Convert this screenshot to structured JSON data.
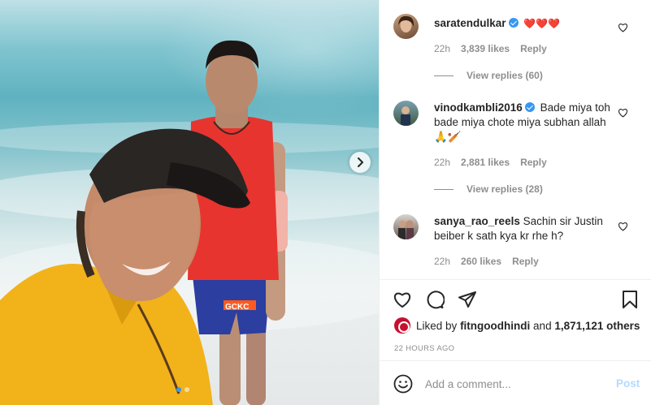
{
  "post_photo": {
    "cap_text": "GCKC"
  },
  "carousel": {
    "next_icon": "chevron-right-icon",
    "slide_count": 2,
    "active_index": 0
  },
  "comments": [
    {
      "username": "saratendulkar",
      "verified": true,
      "text": "❤️❤️❤️",
      "time": "22h",
      "likes": "3,839 likes",
      "reply_label": "Reply",
      "view_replies": "View replies (60)"
    },
    {
      "username": "vinodkambli2016",
      "verified": true,
      "text": "Bade miya toh bade miya chote miya subhan allah🙏🏏",
      "time": "22h",
      "likes": "2,881 likes",
      "reply_label": "Reply",
      "view_replies": "View replies (28)"
    },
    {
      "username": "sanya_rao_reels",
      "verified": false,
      "text": "Sachin sir Justin beiber k sath kya kr rhe h?",
      "time": "22h",
      "likes": "260 likes",
      "reply_label": "Reply"
    }
  ],
  "actions": {
    "like_icon": "heart-outline-icon",
    "comment_icon": "comment-bubble-icon",
    "share_icon": "paper-plane-icon",
    "save_icon": "bookmark-icon"
  },
  "likes_summary": {
    "prefix": "Liked by",
    "user": "fitngoodhindi",
    "joiner": "and",
    "others": "1,871,121 others"
  },
  "time_ago": "22 HOURS AGO",
  "add_comment": {
    "emoji_icon": "smiley-icon",
    "placeholder": "Add a comment...",
    "post_label": "Post"
  },
  "colors": {
    "accent": "#3897f0",
    "post_disabled": "#b3dbff",
    "muted": "#8e8e8e",
    "text": "#262626",
    "heart": "#ed4956"
  }
}
